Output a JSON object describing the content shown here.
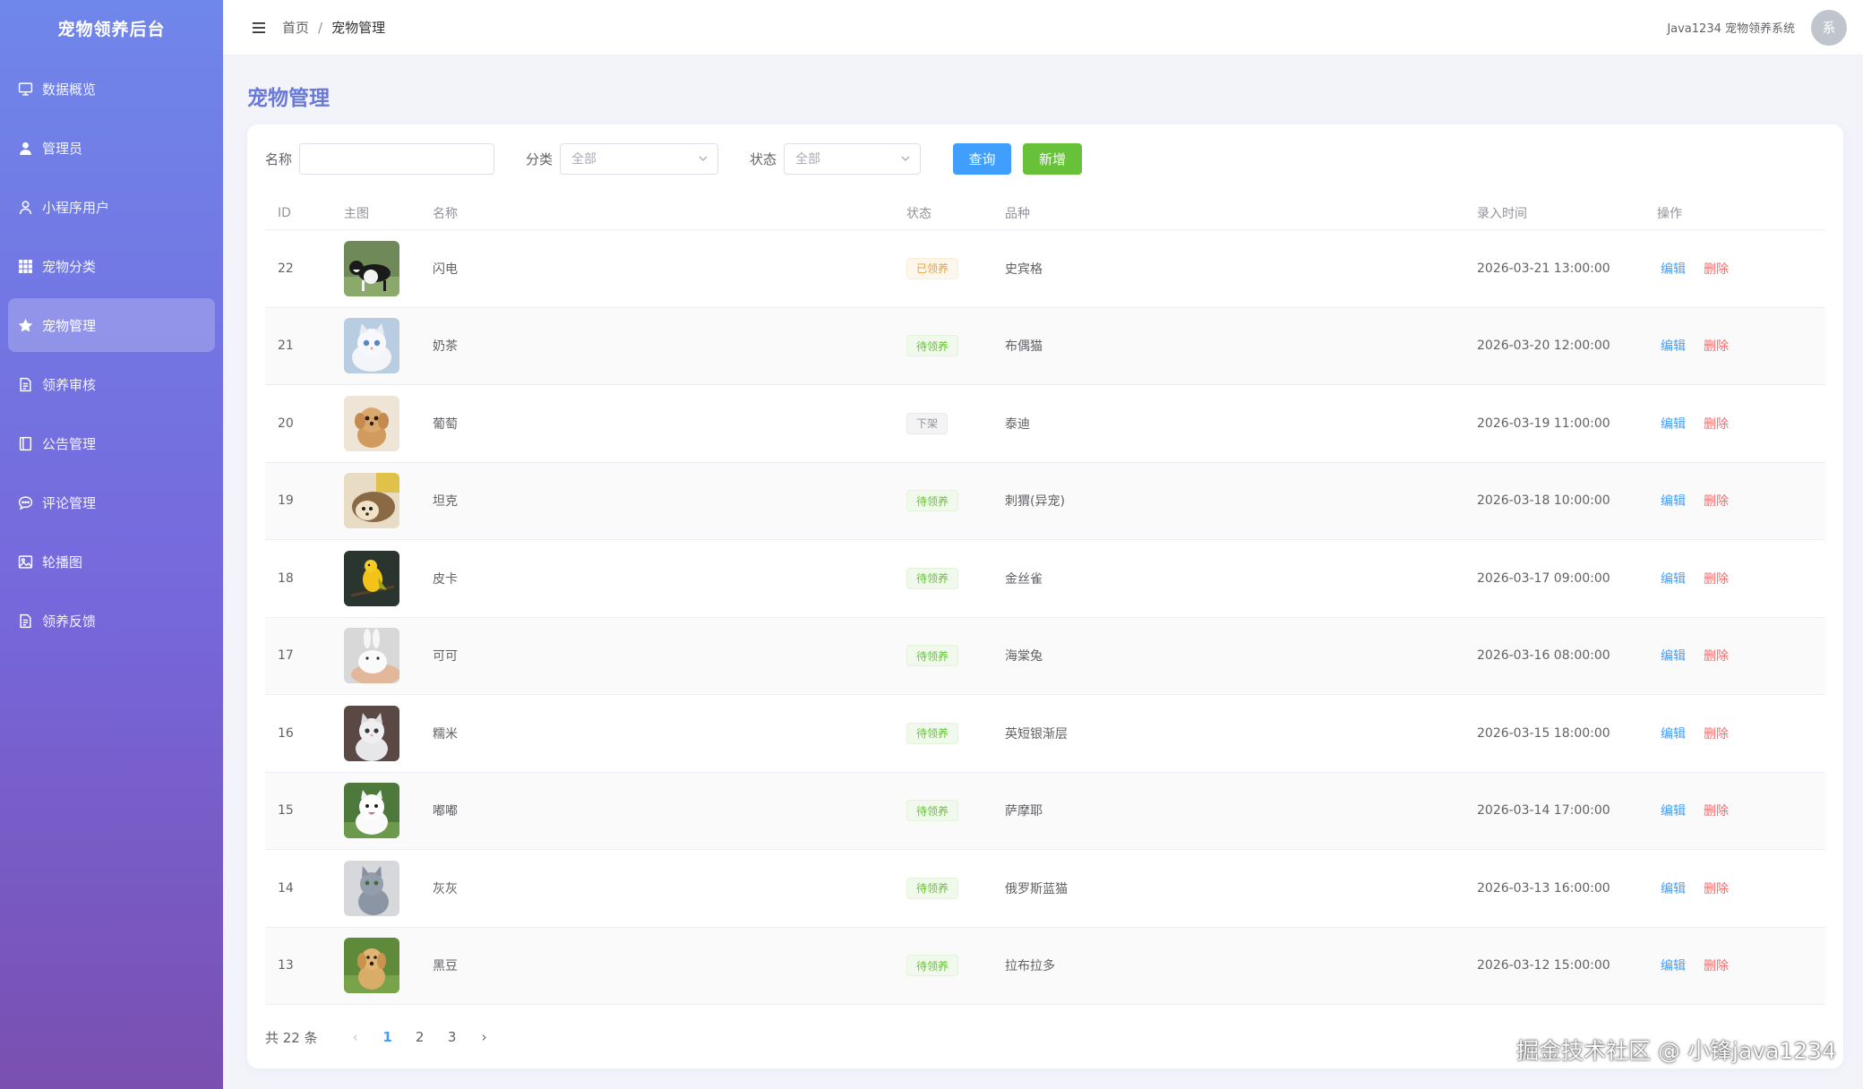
{
  "sidebar": {
    "brand": "宠物领养后台",
    "items": [
      {
        "label": "数据概览",
        "icon": "monitor-icon"
      },
      {
        "label": "管理员",
        "icon": "user-filled-icon"
      },
      {
        "label": "小程序用户",
        "icon": "user-icon"
      },
      {
        "label": "宠物分类",
        "icon": "grid-icon"
      },
      {
        "label": "宠物管理",
        "icon": "star-icon",
        "active": true
      },
      {
        "label": "领养审核",
        "icon": "document-icon"
      },
      {
        "label": "公告管理",
        "icon": "notebook-icon"
      },
      {
        "label": "评论管理",
        "icon": "chat-icon"
      },
      {
        "label": "轮播图",
        "icon": "picture-icon"
      },
      {
        "label": "领养反馈",
        "icon": "document-icon"
      }
    ]
  },
  "header": {
    "breadcrumb": [
      "首页",
      "宠物管理"
    ],
    "separator": "/",
    "system_name": "Java1234 宠物领养系统",
    "avatar_text": "系"
  },
  "main": {
    "title": "宠物管理",
    "filters": {
      "name_label": "名称",
      "name_value": "",
      "category_label": "分类",
      "category_value": "全部",
      "status_label": "状态",
      "status_value": "全部",
      "query_button": "查询",
      "add_button": "新增"
    },
    "table": {
      "columns": [
        "ID",
        "主图",
        "名称",
        "状态",
        "品种",
        "录入时间",
        "操作"
      ],
      "edit_label": "编辑",
      "delete_label": "删除",
      "rows": [
        {
          "id": "22",
          "name": "闪电",
          "status": "已领养",
          "status_type": "warning",
          "breed": "史宾格",
          "time": "2026-03-21 13:00:00",
          "image": "border-collie"
        },
        {
          "id": "21",
          "name": "奶茶",
          "status": "待领养",
          "status_type": "success",
          "breed": "布偶猫",
          "time": "2026-03-20 12:00:00",
          "image": "ragdoll-cat"
        },
        {
          "id": "20",
          "name": "葡萄",
          "status": "下架",
          "status_type": "info",
          "breed": "泰迪",
          "time": "2026-03-19 11:00:00",
          "image": "teddy-dog"
        },
        {
          "id": "19",
          "name": "坦克",
          "status": "待领养",
          "status_type": "success",
          "breed": "刺猬(异宠)",
          "time": "2026-03-18 10:00:00",
          "image": "hedgehog"
        },
        {
          "id": "18",
          "name": "皮卡",
          "status": "待领养",
          "status_type": "success",
          "breed": "金丝雀",
          "time": "2026-03-17 09:00:00",
          "image": "canary"
        },
        {
          "id": "17",
          "name": "可可",
          "status": "待领养",
          "status_type": "success",
          "breed": "海棠兔",
          "time": "2026-03-16 08:00:00",
          "image": "white-rabbit"
        },
        {
          "id": "16",
          "name": "糯米",
          "status": "待领养",
          "status_type": "success",
          "breed": "英短银渐层",
          "time": "2026-03-15 18:00:00",
          "image": "silver-cat"
        },
        {
          "id": "15",
          "name": "嘟嘟",
          "status": "待领养",
          "status_type": "success",
          "breed": "萨摩耶",
          "time": "2026-03-14 17:00:00",
          "image": "samoyed"
        },
        {
          "id": "14",
          "name": "灰灰",
          "status": "待领养",
          "status_type": "success",
          "breed": "俄罗斯蓝猫",
          "time": "2026-03-13 16:00:00",
          "image": "blue-cat"
        },
        {
          "id": "13",
          "name": "黑豆",
          "status": "待领养",
          "status_type": "success",
          "breed": "拉布拉多",
          "time": "2026-03-12 15:00:00",
          "image": "labrador"
        }
      ]
    },
    "pagination": {
      "total_text": "共 22 条",
      "pages": [
        "1",
        "2",
        "3"
      ],
      "current_page": "1",
      "prev": "‹",
      "next": "›"
    }
  },
  "watermark": "掘金技术社区 @ 小锋java1234",
  "colors": {
    "accent": "#409eff",
    "success": "#67c23a",
    "danger": "#f56c6c",
    "warning": "#e6a23c",
    "title": "#6b7ad7"
  }
}
